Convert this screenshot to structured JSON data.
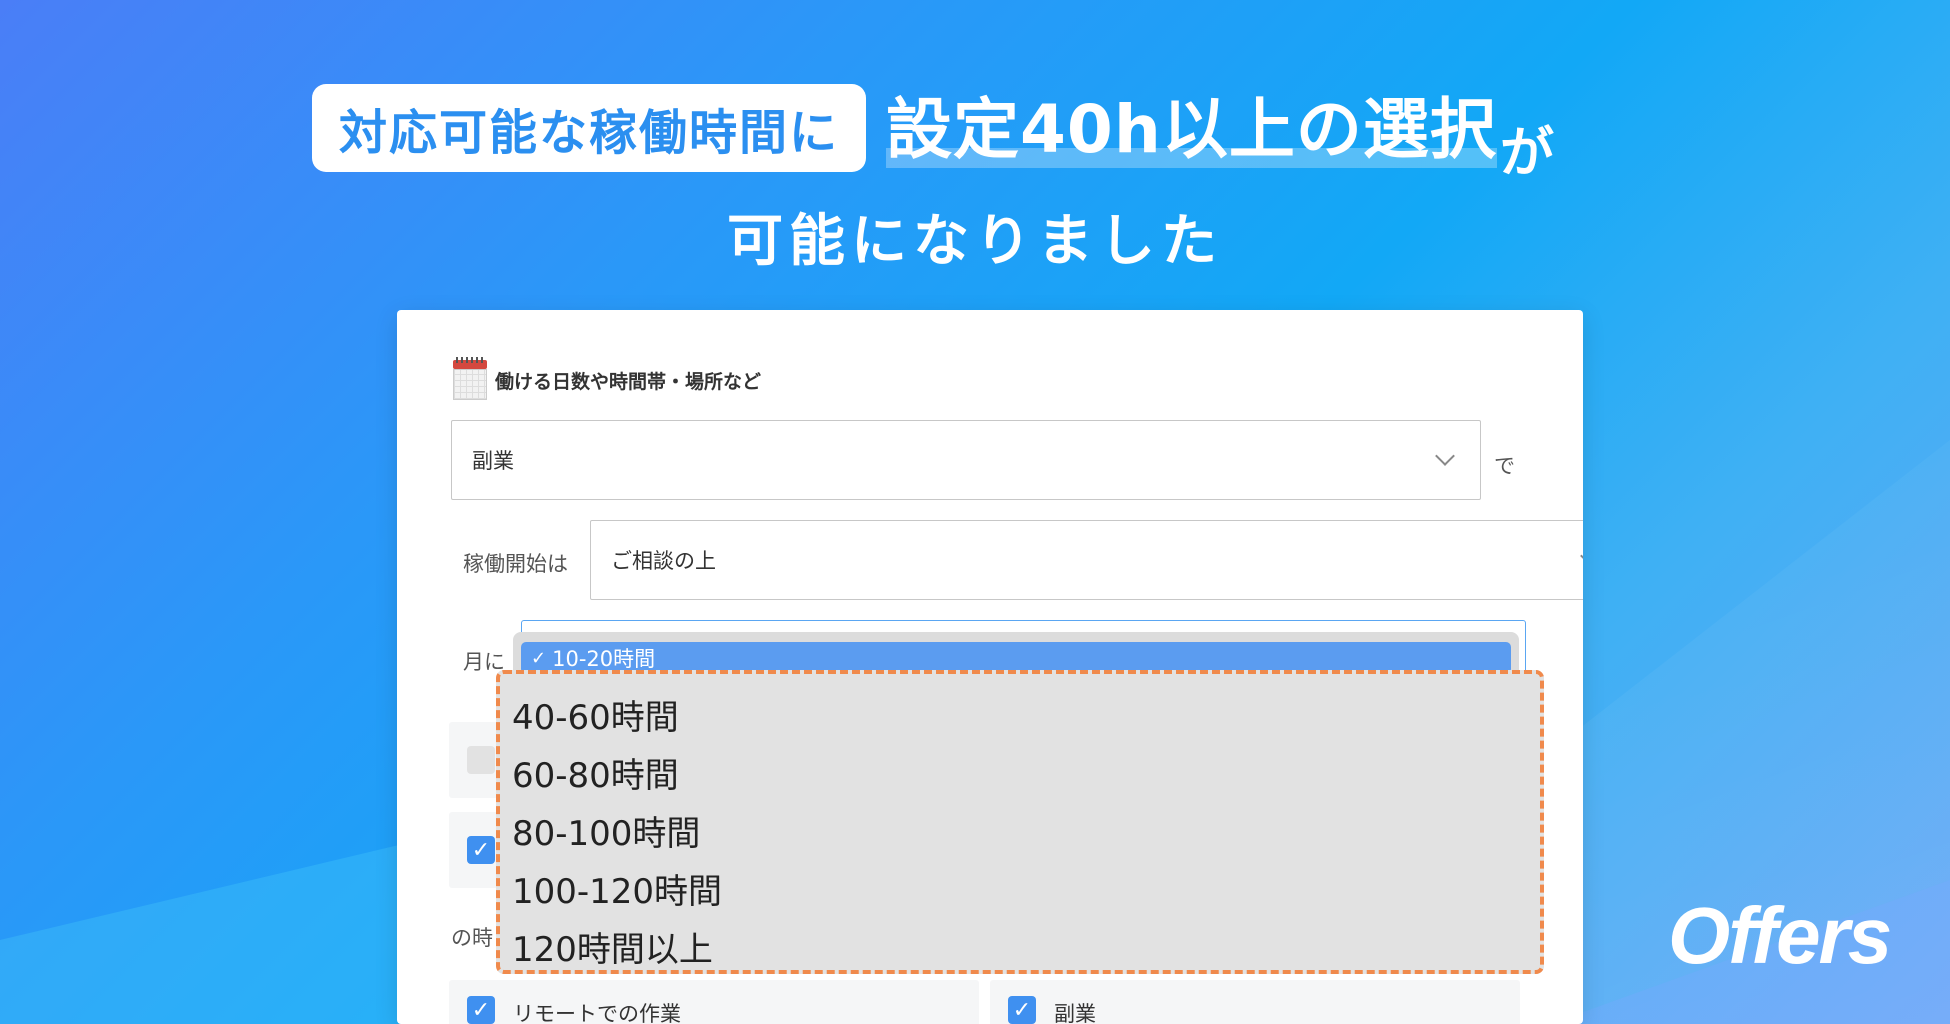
{
  "headline": {
    "pill": "対応可能な稼働時間に",
    "emphasis": "設定40h以上の選択",
    "tail": "が",
    "line2": "可能になりました"
  },
  "form": {
    "section_title": "働ける日数や時間帯・場所など",
    "work_type": {
      "value": "副業",
      "suffix": "で"
    },
    "start": {
      "label": "稼働開始は",
      "value": "ご相談の上"
    },
    "hours": {
      "label_prefix": "月に",
      "selected": "10-20時間",
      "options": [
        "40-60時間",
        "60-80時間",
        "80-100時間",
        "100-120時間",
        "120時間以上"
      ]
    },
    "partial_label": "の時",
    "checkboxes": [
      {
        "label": "リモートでの作業",
        "checked": true
      },
      {
        "label": "副業",
        "checked": true
      }
    ]
  },
  "brand": {
    "logo": "Offers"
  },
  "colors": {
    "accent": "#3f90f0",
    "highlight_border": "#f08a4c"
  }
}
